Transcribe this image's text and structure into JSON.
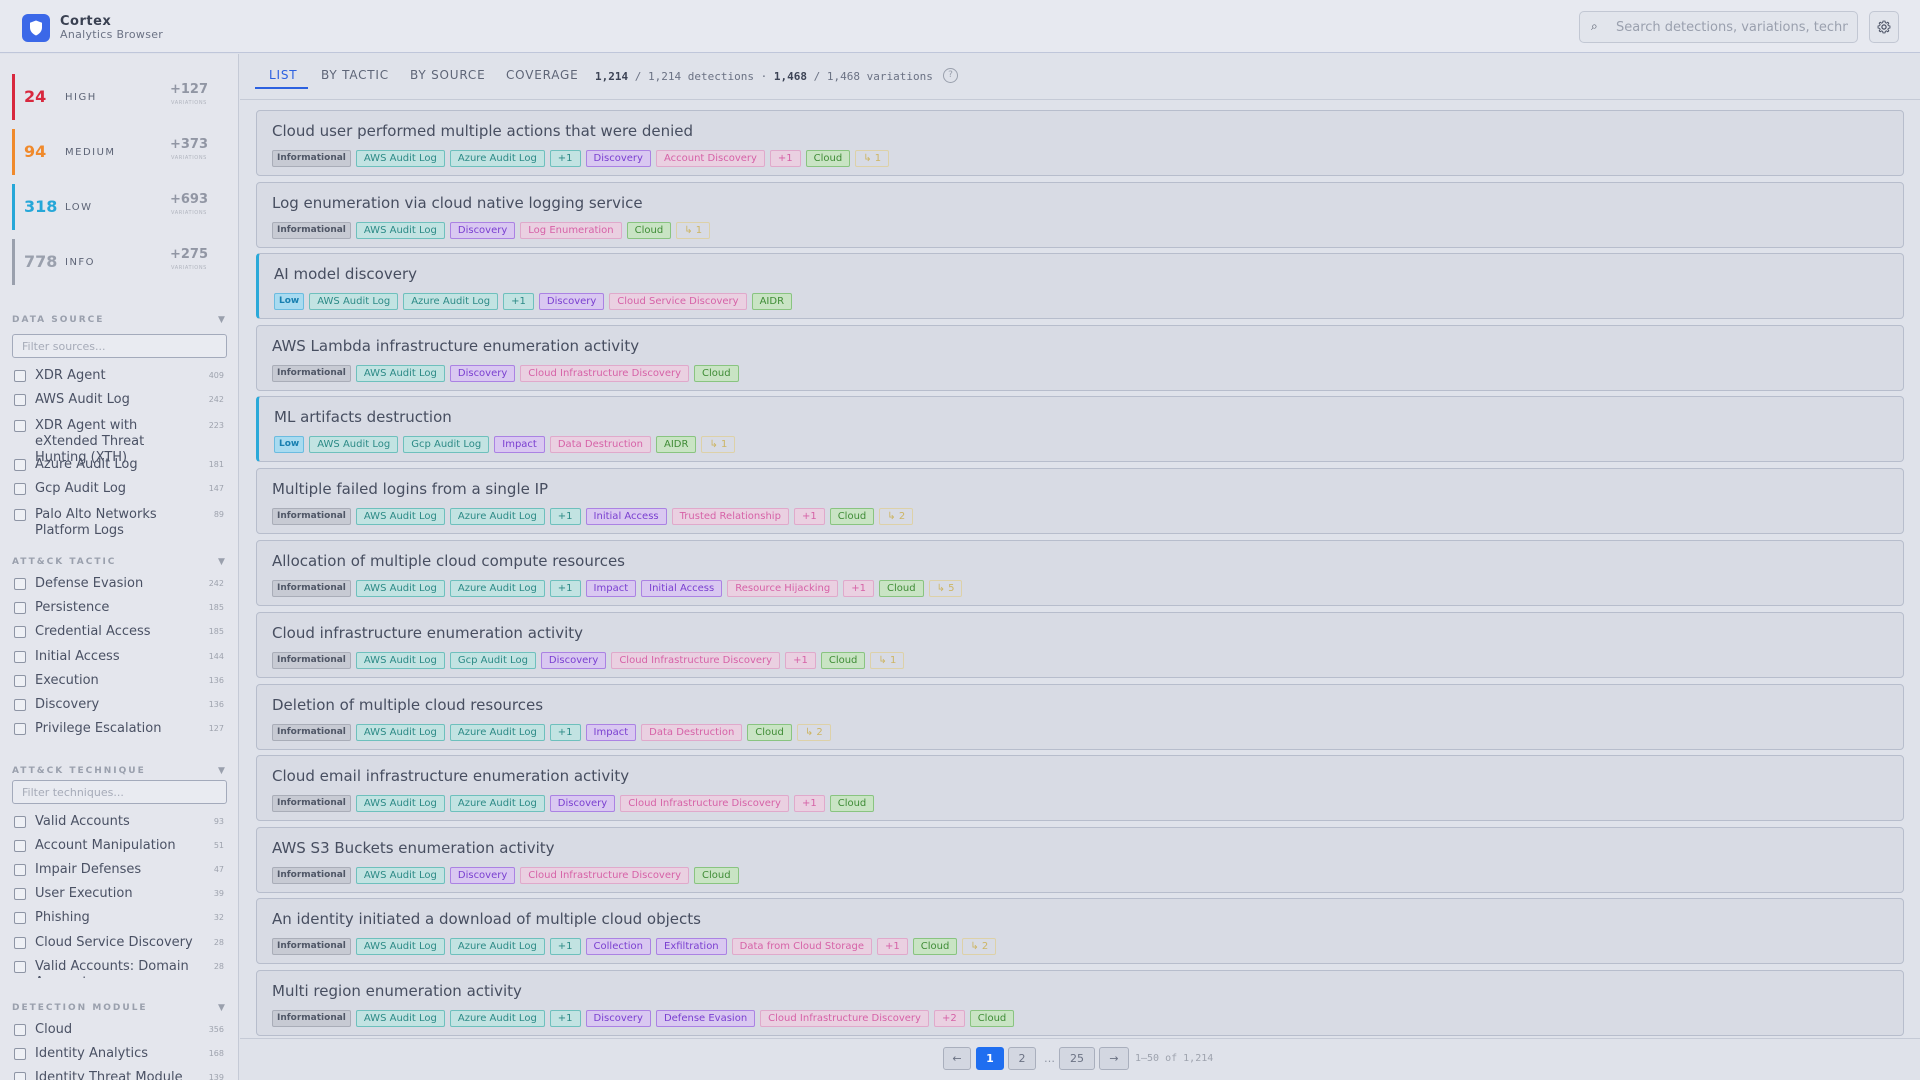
{
  "app": {
    "name": "Cortex",
    "subtitle": "Analytics Browser"
  },
  "search": {
    "placeholder": "Search detections, variations, techniques..."
  },
  "severity": [
    {
      "count": "24",
      "label": "HIGH",
      "variations": "+127",
      "variations_label": "VARIATIONS",
      "color": "#d8283e"
    },
    {
      "count": "94",
      "label": "MEDIUM",
      "variations": "+373",
      "variations_label": "VARIATIONS",
      "color": "#f08a2c"
    },
    {
      "count": "318",
      "label": "LOW",
      "variations": "+693",
      "variations_label": "VARIATIONS",
      "color": "#26a7d8"
    },
    {
      "count": "778",
      "label": "INFO",
      "variations": "+275",
      "variations_label": "VARIATIONS",
      "color": "#9aa0ad"
    }
  ],
  "data_source": {
    "title": "DATA SOURCE",
    "placeholder": "Filter sources...",
    "items": [
      {
        "label": "XDR Agent",
        "count": "409"
      },
      {
        "label": "AWS Audit Log",
        "count": "242"
      },
      {
        "label": "XDR Agent with eXtended Threat Hunting (XTH)",
        "count": "223"
      },
      {
        "label": "Azure Audit Log",
        "count": "181"
      },
      {
        "label": "Gcp Audit Log",
        "count": "147"
      },
      {
        "label": "Palo Alto Networks Platform Logs",
        "count": "89"
      }
    ]
  },
  "attack_tactic": {
    "title": "ATT&CK TACTIC",
    "items": [
      {
        "label": "Defense Evasion",
        "count": "242"
      },
      {
        "label": "Persistence",
        "count": "185"
      },
      {
        "label": "Credential Access",
        "count": "185"
      },
      {
        "label": "Initial Access",
        "count": "144"
      },
      {
        "label": "Execution",
        "count": "136"
      },
      {
        "label": "Discovery",
        "count": "136"
      },
      {
        "label": "Privilege Escalation",
        "count": "127"
      }
    ]
  },
  "attack_technique": {
    "title": "ATT&CK TECHNIQUE",
    "placeholder": "Filter techniques...",
    "items": [
      {
        "label": "Valid Accounts",
        "count": "93"
      },
      {
        "label": "Account Manipulation",
        "count": "51"
      },
      {
        "label": "Impair Defenses",
        "count": "47"
      },
      {
        "label": "User Execution",
        "count": "39"
      },
      {
        "label": "Phishing",
        "count": "32"
      },
      {
        "label": "Cloud Service Discovery",
        "count": "28"
      },
      {
        "label": "Valid Accounts: Domain Accounts",
        "count": "28"
      }
    ]
  },
  "detection_module": {
    "title": "DETECTION MODULE",
    "items": [
      {
        "label": "Cloud",
        "count": "356"
      },
      {
        "label": "Identity Analytics",
        "count": "168"
      },
      {
        "label": "Identity Threat Module",
        "count": "139"
      }
    ]
  },
  "tabs": [
    "LIST",
    "BY TACTIC",
    "BY SOURCE",
    "COVERAGE"
  ],
  "stats": {
    "detections": "1,214",
    "detections_total": "1,214",
    "detections_label": "detections",
    "variations": "1,468",
    "variations_total": "1,468",
    "variations_label": "variations"
  },
  "help_label": "?",
  "detections": [
    {
      "title": "Cloud user performed multiple actions that were denied",
      "severity": "low-none",
      "tags": [
        [
          "info",
          "Informational"
        ],
        [
          "src",
          "AWS Audit Log"
        ],
        [
          "src",
          "Azure Audit Log"
        ],
        [
          "src",
          "+1"
        ],
        [
          "tac",
          "Discovery"
        ],
        [
          "tech",
          "Account Discovery"
        ],
        [
          "tech",
          "+1"
        ],
        [
          "mod",
          "Cloud"
        ],
        [
          "var",
          "↳ 1"
        ]
      ]
    },
    {
      "title": "Log enumeration via cloud native logging service",
      "tags": [
        [
          "info",
          "Informational"
        ],
        [
          "src",
          "AWS Audit Log"
        ],
        [
          "tac",
          "Discovery"
        ],
        [
          "tech",
          "Log Enumeration"
        ],
        [
          "mod",
          "Cloud"
        ],
        [
          "var",
          "↳ 1"
        ]
      ]
    },
    {
      "title": "AI model discovery",
      "low": true,
      "tags": [
        [
          "low",
          "Low"
        ],
        [
          "src",
          "AWS Audit Log"
        ],
        [
          "src",
          "Azure Audit Log"
        ],
        [
          "src",
          "+1"
        ],
        [
          "tac",
          "Discovery"
        ],
        [
          "tech",
          "Cloud Service Discovery"
        ],
        [
          "mod",
          "AIDR"
        ]
      ]
    },
    {
      "title": "AWS Lambda infrastructure enumeration activity",
      "tags": [
        [
          "info",
          "Informational"
        ],
        [
          "src",
          "AWS Audit Log"
        ],
        [
          "tac",
          "Discovery"
        ],
        [
          "tech",
          "Cloud Infrastructure Discovery"
        ],
        [
          "mod",
          "Cloud"
        ]
      ]
    },
    {
      "title": "ML artifacts destruction",
      "low": true,
      "tags": [
        [
          "low",
          "Low"
        ],
        [
          "src",
          "AWS Audit Log"
        ],
        [
          "src",
          "Gcp Audit Log"
        ],
        [
          "tac",
          "Impact"
        ],
        [
          "tech",
          "Data Destruction"
        ],
        [
          "mod",
          "AIDR"
        ],
        [
          "var",
          "↳ 1"
        ]
      ]
    },
    {
      "title": "Multiple failed logins from a single IP",
      "tags": [
        [
          "info",
          "Informational"
        ],
        [
          "src",
          "AWS Audit Log"
        ],
        [
          "src",
          "Azure Audit Log"
        ],
        [
          "src",
          "+1"
        ],
        [
          "tac",
          "Initial Access"
        ],
        [
          "tech",
          "Trusted Relationship"
        ],
        [
          "tech",
          "+1"
        ],
        [
          "mod",
          "Cloud"
        ],
        [
          "var",
          "↳ 2"
        ]
      ]
    },
    {
      "title": "Allocation of multiple cloud compute resources",
      "tags": [
        [
          "info",
          "Informational"
        ],
        [
          "src",
          "AWS Audit Log"
        ],
        [
          "src",
          "Azure Audit Log"
        ],
        [
          "src",
          "+1"
        ],
        [
          "tac",
          "Impact"
        ],
        [
          "tac",
          "Initial Access"
        ],
        [
          "tech",
          "Resource Hijacking"
        ],
        [
          "tech",
          "+1"
        ],
        [
          "mod",
          "Cloud"
        ],
        [
          "var",
          "↳ 5"
        ]
      ]
    },
    {
      "title": "Cloud infrastructure enumeration activity",
      "tags": [
        [
          "info",
          "Informational"
        ],
        [
          "src",
          "AWS Audit Log"
        ],
        [
          "src",
          "Gcp Audit Log"
        ],
        [
          "tac",
          "Discovery"
        ],
        [
          "tech",
          "Cloud Infrastructure Discovery"
        ],
        [
          "tech",
          "+1"
        ],
        [
          "mod",
          "Cloud"
        ],
        [
          "var",
          "↳ 1"
        ]
      ]
    },
    {
      "title": "Deletion of multiple cloud resources",
      "tags": [
        [
          "info",
          "Informational"
        ],
        [
          "src",
          "AWS Audit Log"
        ],
        [
          "src",
          "Azure Audit Log"
        ],
        [
          "src",
          "+1"
        ],
        [
          "tac",
          "Impact"
        ],
        [
          "tech",
          "Data Destruction"
        ],
        [
          "mod",
          "Cloud"
        ],
        [
          "var",
          "↳ 2"
        ]
      ]
    },
    {
      "title": "Cloud email infrastructure enumeration activity",
      "tags": [
        [
          "info",
          "Informational"
        ],
        [
          "src",
          "AWS Audit Log"
        ],
        [
          "src",
          "Azure Audit Log"
        ],
        [
          "tac",
          "Discovery"
        ],
        [
          "tech",
          "Cloud Infrastructure Discovery"
        ],
        [
          "tech",
          "+1"
        ],
        [
          "mod",
          "Cloud"
        ]
      ]
    },
    {
      "title": "AWS S3 Buckets enumeration activity",
      "tags": [
        [
          "info",
          "Informational"
        ],
        [
          "src",
          "AWS Audit Log"
        ],
        [
          "tac",
          "Discovery"
        ],
        [
          "tech",
          "Cloud Infrastructure Discovery"
        ],
        [
          "mod",
          "Cloud"
        ]
      ]
    },
    {
      "title": "An identity initiated a download of multiple cloud objects",
      "tags": [
        [
          "info",
          "Informational"
        ],
        [
          "src",
          "AWS Audit Log"
        ],
        [
          "src",
          "Azure Audit Log"
        ],
        [
          "src",
          "+1"
        ],
        [
          "tac",
          "Collection"
        ],
        [
          "tac",
          "Exfiltration"
        ],
        [
          "tech",
          "Data from Cloud Storage"
        ],
        [
          "tech",
          "+1"
        ],
        [
          "mod",
          "Cloud"
        ],
        [
          "var",
          "↳ 2"
        ]
      ]
    },
    {
      "title": "Multi region enumeration activity",
      "tags": [
        [
          "info",
          "Informational"
        ],
        [
          "src",
          "AWS Audit Log"
        ],
        [
          "src",
          "Azure Audit Log"
        ],
        [
          "src",
          "+1"
        ],
        [
          "tac",
          "Discovery"
        ],
        [
          "tac",
          "Defense Evasion"
        ],
        [
          "tech",
          "Cloud Infrastructure Discovery"
        ],
        [
          "tech",
          "+2"
        ],
        [
          "mod",
          "Cloud"
        ]
      ]
    }
  ],
  "pagination": {
    "prev": "←",
    "pages": [
      "1",
      "2"
    ],
    "dots": "…",
    "last": "25",
    "next": "→",
    "range": "1–50 of 1,214"
  },
  "colors": {
    "accent": "#1f6ef0",
    "tab_active": "#2c61e0"
  }
}
